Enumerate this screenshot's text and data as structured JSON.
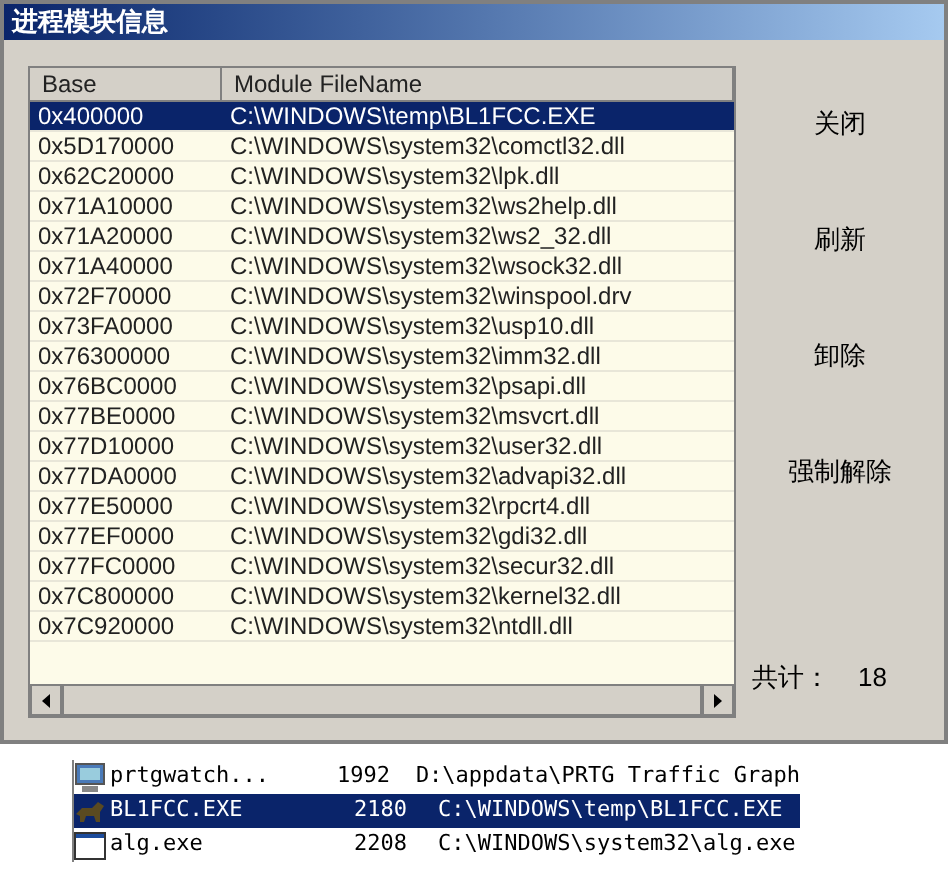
{
  "window": {
    "title": "进程模块信息"
  },
  "table": {
    "columns": [
      "Base",
      "Module FileName"
    ],
    "rows": [
      {
        "base": "0x400000",
        "file": "C:\\WINDOWS\\temp\\BL1FCC.EXE",
        "selected": true
      },
      {
        "base": "0x5D170000",
        "file": "C:\\WINDOWS\\system32\\comctl32.dll",
        "selected": false
      },
      {
        "base": "0x62C20000",
        "file": "C:\\WINDOWS\\system32\\lpk.dll",
        "selected": false
      },
      {
        "base": "0x71A10000",
        "file": "C:\\WINDOWS\\system32\\ws2help.dll",
        "selected": false
      },
      {
        "base": "0x71A20000",
        "file": "C:\\WINDOWS\\system32\\ws2_32.dll",
        "selected": false
      },
      {
        "base": "0x71A40000",
        "file": "C:\\WINDOWS\\system32\\wsock32.dll",
        "selected": false
      },
      {
        "base": "0x72F70000",
        "file": "C:\\WINDOWS\\system32\\winspool.drv",
        "selected": false
      },
      {
        "base": "0x73FA0000",
        "file": "C:\\WINDOWS\\system32\\usp10.dll",
        "selected": false
      },
      {
        "base": "0x76300000",
        "file": "C:\\WINDOWS\\system32\\imm32.dll",
        "selected": false
      },
      {
        "base": "0x76BC0000",
        "file": "C:\\WINDOWS\\system32\\psapi.dll",
        "selected": false
      },
      {
        "base": "0x77BE0000",
        "file": "C:\\WINDOWS\\system32\\msvcrt.dll",
        "selected": false
      },
      {
        "base": "0x77D10000",
        "file": "C:\\WINDOWS\\system32\\user32.dll",
        "selected": false
      },
      {
        "base": "0x77DA0000",
        "file": "C:\\WINDOWS\\system32\\advapi32.dll",
        "selected": false
      },
      {
        "base": "0x77E50000",
        "file": "C:\\WINDOWS\\system32\\rpcrt4.dll",
        "selected": false
      },
      {
        "base": "0x77EF0000",
        "file": "C:\\WINDOWS\\system32\\gdi32.dll",
        "selected": false
      },
      {
        "base": "0x77FC0000",
        "file": "C:\\WINDOWS\\system32\\secur32.dll",
        "selected": false
      },
      {
        "base": "0x7C800000",
        "file": "C:\\WINDOWS\\system32\\kernel32.dll",
        "selected": false
      },
      {
        "base": "0x7C920000",
        "file": "C:\\WINDOWS\\system32\\ntdll.dll",
        "selected": false
      }
    ]
  },
  "buttons": [
    "关闭",
    "刷新",
    "卸除",
    "强制解除"
  ],
  "total": {
    "label": "共计：",
    "value": "18"
  },
  "processes": [
    {
      "name": "prtgwatch...",
      "pid": "1992",
      "path": "D:\\appdata\\PRTG Traffic Graph",
      "selected": false,
      "kind": "monitor"
    },
    {
      "name": "BL1FCC.EXE",
      "pid": "2180",
      "path": "C:\\WINDOWS\\temp\\BL1FCC.EXE",
      "selected": true,
      "kind": "dog"
    },
    {
      "name": "alg.exe",
      "pid": "2208",
      "path": "C:\\WINDOWS\\system32\\alg.exe",
      "selected": false,
      "kind": "window"
    }
  ]
}
